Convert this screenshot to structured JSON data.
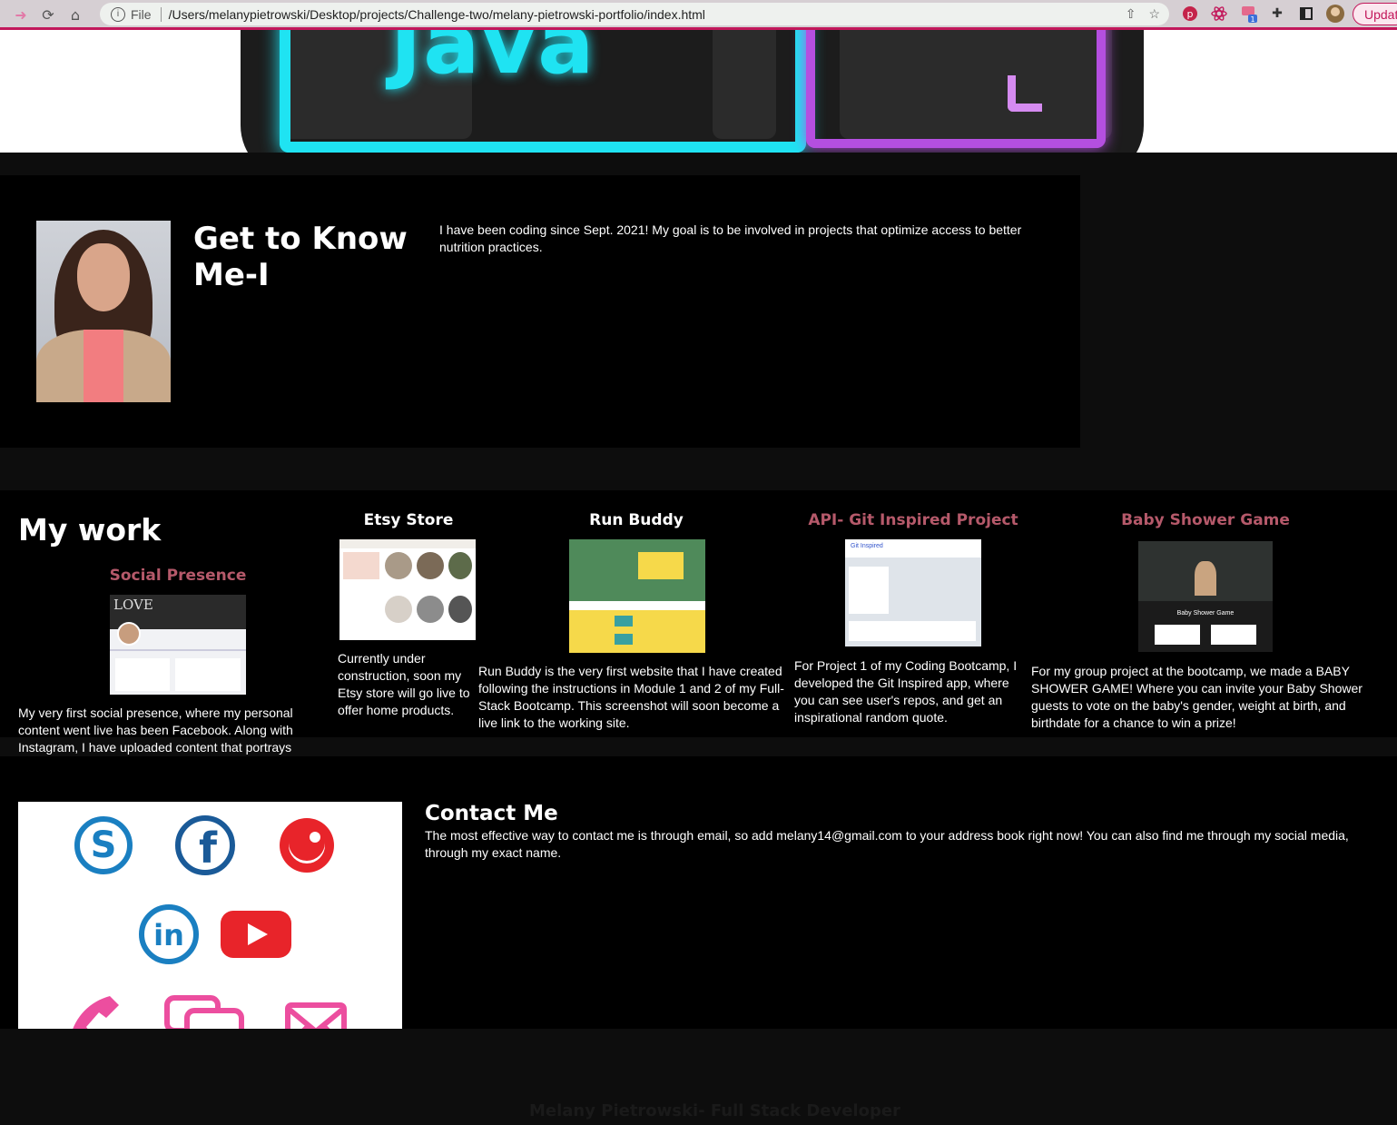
{
  "browser": {
    "scheme": "File",
    "url": "/Users/melanypietrowski/Desktop/projects/Challenge-two/melany-pietrowski-portfolio/index.html",
    "update_label": "Updat",
    "extension_badge": "1"
  },
  "hero": {
    "banner_text": "Java"
  },
  "about": {
    "title": "Get to Know Me-I",
    "text": "I have been coding since Sept. 2021! My goal is to be involved in projects that optimize access to better nutrition practices."
  },
  "work": {
    "heading": "My work",
    "projects": [
      {
        "title": "Social Presence",
        "description": "My very first social presence, where my personal content went live has been Facebook. Along with Instagram, I have uploaded content that portrays some of my hobbies and day-to-day activities.",
        "thumb_caption": "LOVE"
      },
      {
        "title": "Etsy Store",
        "description": "Currently under construction, soon my Etsy store will go live to offer home products."
      },
      {
        "title": "Run Buddy",
        "description": "Run Buddy is the very first website that I have created following the instructions in Module 1 and 2 of my Full-Stack Bootcamp. This screenshot will soon become a live link to the working site."
      },
      {
        "title": "API- Git Inspired Project",
        "description": "For Project 1 of my Coding Bootcamp, I developed the Git Inspired app, where you can see user's repos, and get an inspirational random quote.",
        "thumb_caption": "Git Inspired"
      },
      {
        "title": "Baby Shower Game",
        "description": "For my group project at the bootcamp, we made a BABY SHOWER GAME! Where you can invite your Baby Shower guests to vote on the baby's gender, weight at birth, and birthdate for a chance to win a prize!",
        "thumb_caption": "Baby Shower Game"
      }
    ]
  },
  "contact": {
    "title": "Contact Me",
    "text": "The most effective way to contact me is through email, so add melany14@gmail.com to your address book right now! You can also find me through my social media, through my exact name.",
    "icons": [
      "skype-icon",
      "facebook-icon",
      "smile-icon",
      "linkedin-icon",
      "youtube-icon",
      "phone-icon",
      "chat-icon",
      "mail-icon"
    ],
    "colors": {
      "blue": "#1a7fc1",
      "red": "#e8242a",
      "pink": "#ec4e9f"
    }
  },
  "footer": {
    "text": "Melany Pietrowski- Full Stack Developer"
  }
}
